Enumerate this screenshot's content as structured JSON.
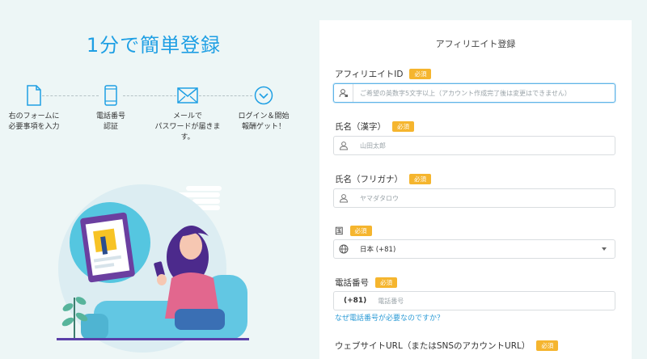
{
  "hero": {
    "title": "1分で簡単登録"
  },
  "steps": [
    {
      "label": "右のフォームに\n必要事項を入力",
      "icon": "document-icon"
    },
    {
      "label": "電話番号\n認証",
      "icon": "smartphone-icon"
    },
    {
      "label": "メールで\nパスワードが届きま\nす。",
      "icon": "envelope-icon"
    },
    {
      "label": "ログイン＆開始\n報酬ゲット！",
      "icon": "chevron-circle-icon"
    }
  ],
  "form": {
    "title": "アフィリエイト登録",
    "required_badge": "必須",
    "affiliate_id": {
      "label": "アフィリエイトID",
      "placeholder": "ご希望の英数字5文字以上（アカウント作成完了後は変更はできません）"
    },
    "name_kanji": {
      "label": "氏名（漢字）",
      "placeholder": "山田太郎"
    },
    "name_kana": {
      "label": "氏名（フリガナ）",
      "placeholder": "ヤマダタロウ"
    },
    "country": {
      "label": "国",
      "value": "日本 (+81)"
    },
    "phone": {
      "label": "電話番号",
      "code": "(+81)",
      "placeholder": "電話番号",
      "help_link": "なぜ電話番号が必要なのですか？"
    },
    "website": {
      "label": "ウェブサイトURL（またはSNSのアカウントURL）"
    }
  },
  "colors": {
    "accent": "#1e9fe4",
    "badge": "#f5b52e",
    "link": "#2c9bd6",
    "background": "#edf6f6"
  }
}
